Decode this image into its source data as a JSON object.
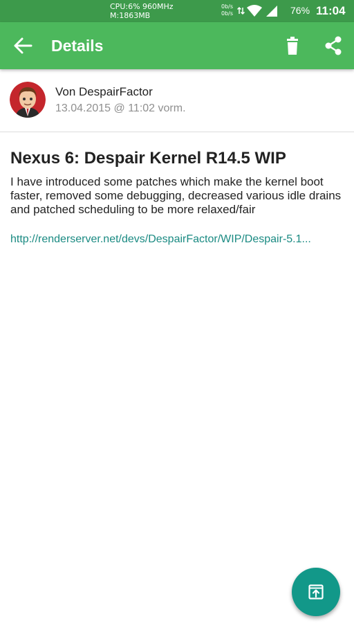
{
  "status_bar": {
    "cpu_line": "CPU:6% 960MHz",
    "mem_line": "M:1863MB",
    "net_up": "0b/s",
    "net_down": "0b/s",
    "battery": "76%",
    "time": "11:04"
  },
  "app_bar": {
    "title": "Details",
    "color": "#4cb85c"
  },
  "author": {
    "name": "Von DespairFactor",
    "date": "13.04.2015 @ 11:02 vorm."
  },
  "post": {
    "title": "Nexus 6: Despair Kernel R14.5 WIP",
    "body": "I have introduced some patches which make the kernel boot faster, removed some debugging, decreased various idle drains and patched scheduling to be more relaxed/fair",
    "link": "http://renderserver.net/devs/DespairFactor/WIP/Despair-5.1..."
  },
  "fab": {
    "icon": "open-in-browser-icon",
    "color": "#129889"
  }
}
